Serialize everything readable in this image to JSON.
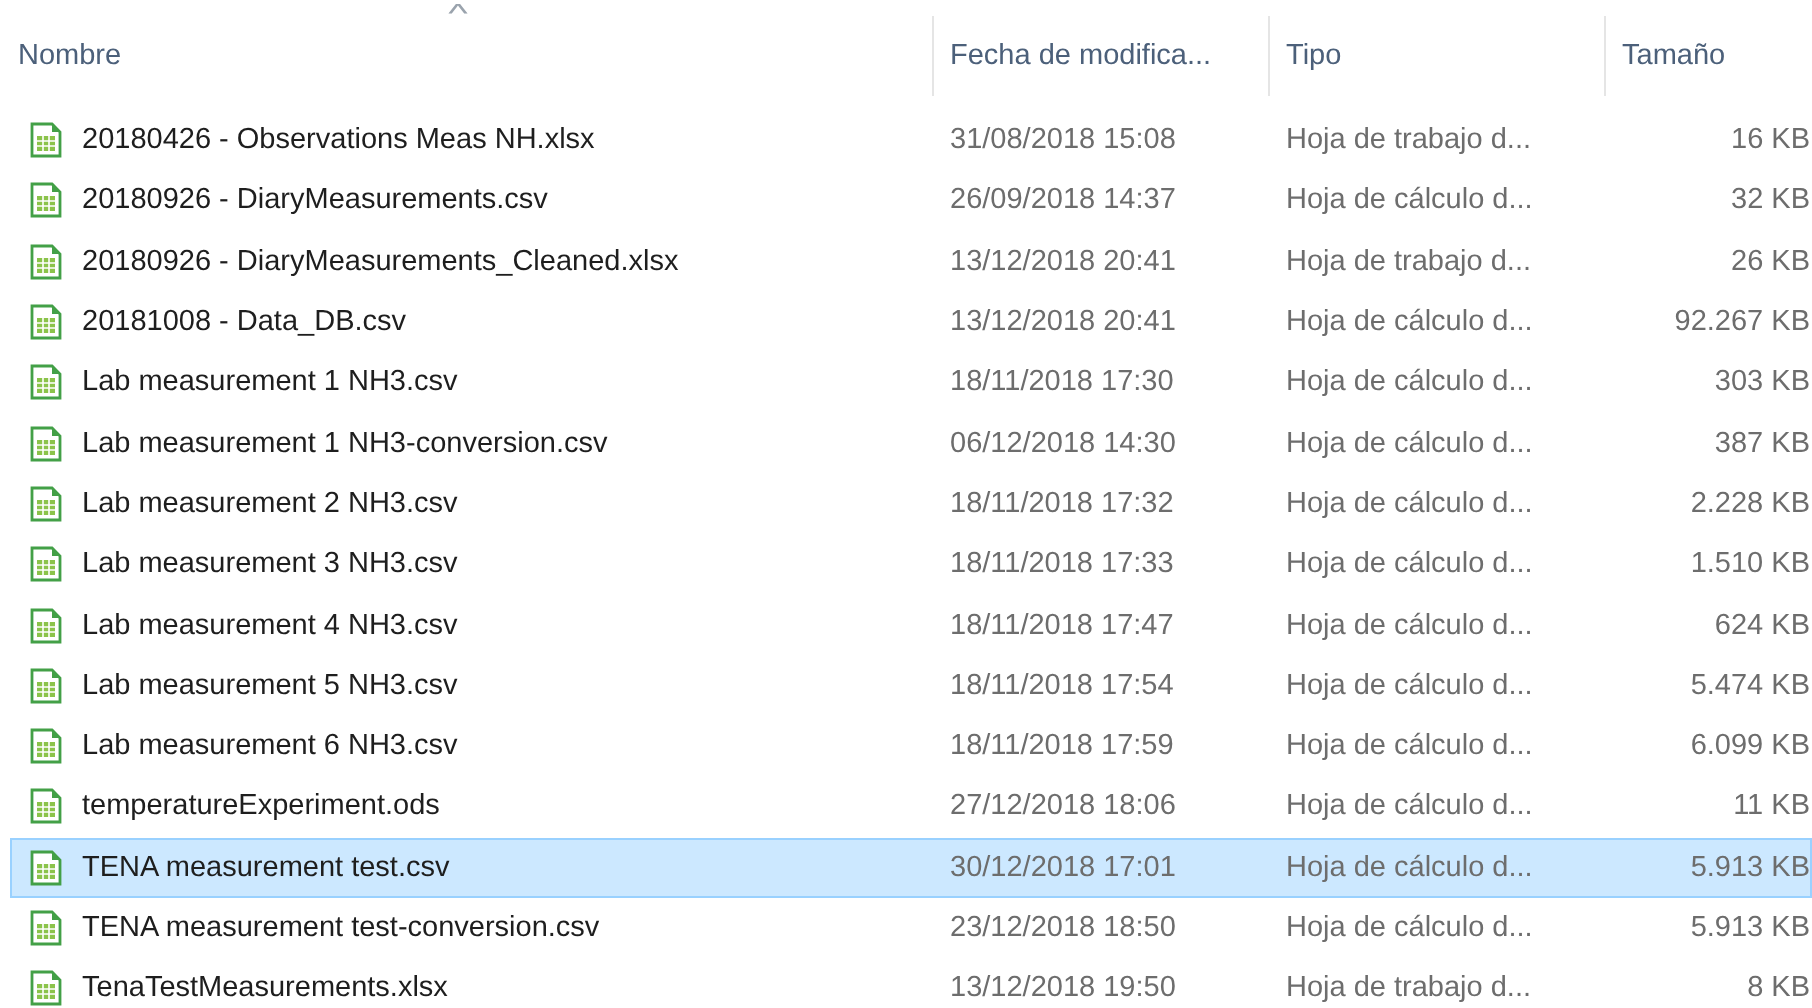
{
  "columns": [
    {
      "label": "Nombre",
      "sorted": true
    },
    {
      "label": "Fecha de modifica..."
    },
    {
      "label": "Tipo"
    },
    {
      "label": "Tamaño"
    }
  ],
  "sort_caret": "^",
  "rows": [
    {
      "name": "20180426 - Observations Meas NH.xlsx",
      "date": "31/08/2018 15:08",
      "type": "Hoja de trabajo d...",
      "size": "16 KB",
      "selected": false
    },
    {
      "name": "20180926 - DiaryMeasurements.csv",
      "date": "26/09/2018 14:37",
      "type": "Hoja de cálculo d...",
      "size": "32 KB",
      "selected": false
    },
    {
      "name": "20180926 - DiaryMeasurements_Cleaned.xlsx",
      "date": "13/12/2018 20:41",
      "type": "Hoja de trabajo d...",
      "size": "26 KB",
      "selected": false
    },
    {
      "name": "20181008 - Data_DB.csv",
      "date": "13/12/2018 20:41",
      "type": "Hoja de cálculo d...",
      "size": "92.267 KB",
      "selected": false
    },
    {
      "name": "Lab measurement 1 NH3.csv",
      "date": "18/11/2018 17:30",
      "type": "Hoja de cálculo d...",
      "size": "303 KB",
      "selected": false
    },
    {
      "name": "Lab measurement 1 NH3-conversion.csv",
      "date": "06/12/2018 14:30",
      "type": "Hoja de cálculo d...",
      "size": "387 KB",
      "selected": false
    },
    {
      "name": "Lab measurement 2 NH3.csv",
      "date": "18/11/2018 17:32",
      "type": "Hoja de cálculo d...",
      "size": "2.228 KB",
      "selected": false
    },
    {
      "name": "Lab measurement 3 NH3.csv",
      "date": "18/11/2018 17:33",
      "type": "Hoja de cálculo d...",
      "size": "1.510 KB",
      "selected": false
    },
    {
      "name": "Lab measurement 4 NH3.csv",
      "date": "18/11/2018 17:47",
      "type": "Hoja de cálculo d...",
      "size": "624 KB",
      "selected": false
    },
    {
      "name": "Lab measurement 5 NH3.csv",
      "date": "18/11/2018 17:54",
      "type": "Hoja de cálculo d...",
      "size": "5.474 KB",
      "selected": false
    },
    {
      "name": "Lab measurement 6 NH3.csv",
      "date": "18/11/2018 17:59",
      "type": "Hoja de cálculo d...",
      "size": "6.099 KB",
      "selected": false
    },
    {
      "name": "temperatureExperiment.ods",
      "date": "27/12/2018 18:06",
      "type": "Hoja de cálculo d...",
      "size": "11 KB",
      "selected": false
    },
    {
      "name": "TENA measurement test.csv",
      "date": "30/12/2018 17:01",
      "type": "Hoja de cálculo d...",
      "size": "5.913 KB",
      "selected": true
    },
    {
      "name": "TENA measurement test-conversion.csv",
      "date": "23/12/2018 18:50",
      "type": "Hoja de cálculo d...",
      "size": "5.913 KB",
      "selected": false
    },
    {
      "name": "TenaTestMeasurements.xlsx",
      "date": "13/12/2018 19:50",
      "type": "Hoja de trabajo d...",
      "size": "8 KB",
      "selected": false
    }
  ]
}
